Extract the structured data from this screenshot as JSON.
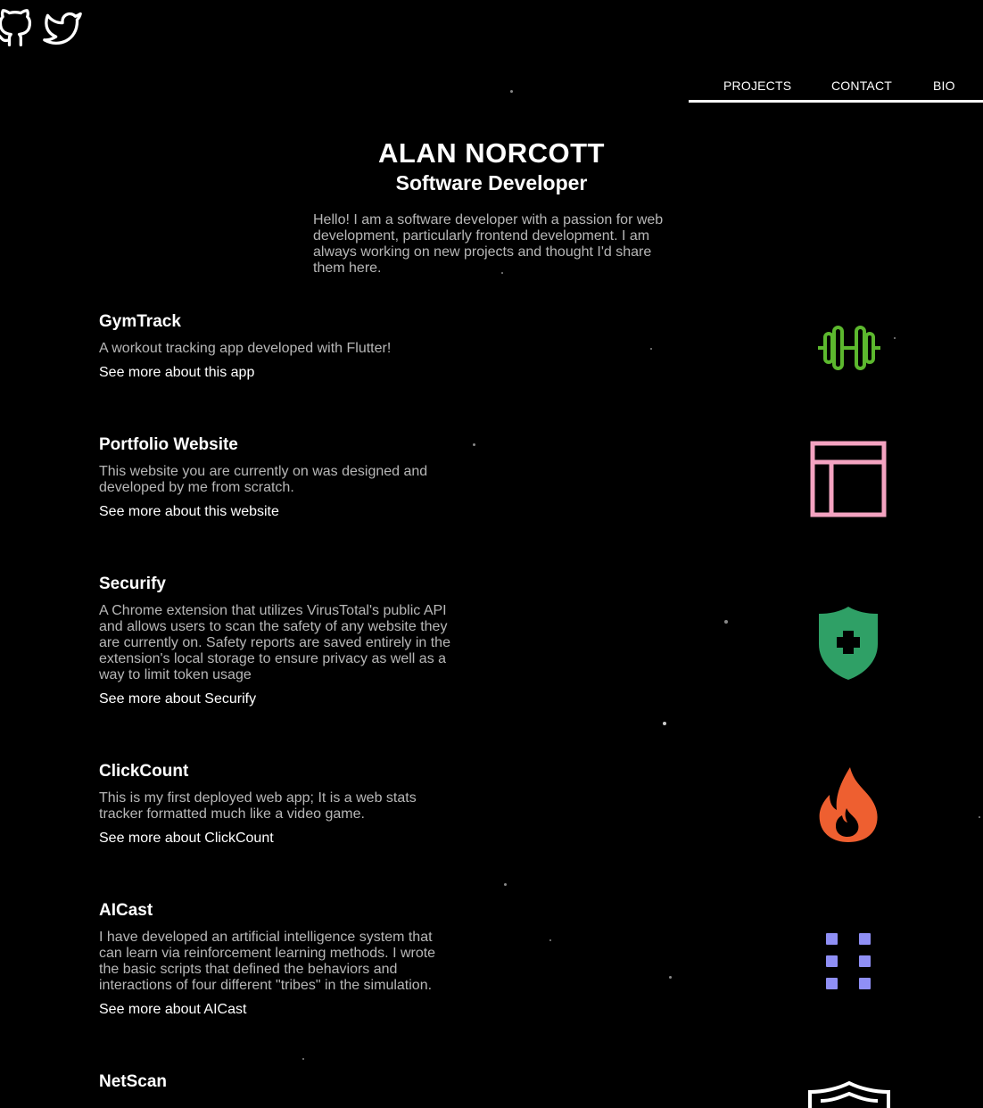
{
  "social": {
    "github_icon": "github-icon",
    "twitter_icon": "twitter-icon"
  },
  "nav": {
    "items": [
      {
        "label": "PROJECTS"
      },
      {
        "label": "CONTACT"
      },
      {
        "label": "BIO"
      }
    ]
  },
  "header": {
    "name": "ALAN NORCOTT",
    "role": "Software Developer",
    "intro": "Hello! I am a software developer with a passion for web development, particularly frontend development. I am always working on new projects and thought I'd share them here."
  },
  "projects": [
    {
      "title": "GymTrack",
      "description": "A workout tracking app developed with Flutter!",
      "link": "See more about this app",
      "icon": "dumbbell-icon",
      "color": "#5cb82e"
    },
    {
      "title": "Portfolio Website",
      "description": "This website you are currently on was designed and developed by me from scratch.",
      "link": "See more about this website",
      "icon": "layout-icon",
      "color": "#f4a3c1"
    },
    {
      "title": "Securify",
      "description": "A Chrome extension that utilizes VirusTotal's public API and allows users to scan the safety of any website they are currently on. Safety reports are saved entirely in the extension's local storage to ensure privacy as well as a way to limit token usage",
      "link": "See more about Securify",
      "icon": "shield-plus-icon",
      "color": "#2fa066"
    },
    {
      "title": "ClickCount",
      "description": "This is my first deployed web app; It is a web stats tracker formatted much like a video game.",
      "link": "See more about ClickCount",
      "icon": "flame-icon",
      "color": "#ee5f30"
    },
    {
      "title": "AICast",
      "description": "I have developed an artificial intelligence system that can learn via reinforcement learning methods. I wrote the basic scripts that defined the behaviors and interactions of four different \"tribes\" in the simulation.",
      "link": "See more about AICast",
      "icon": "grid-dots-icon",
      "color": "#8f8ff5"
    },
    {
      "title": "NetScan",
      "description": "",
      "link": "",
      "icon": "badge-icon",
      "color": "#ffffff"
    }
  ]
}
